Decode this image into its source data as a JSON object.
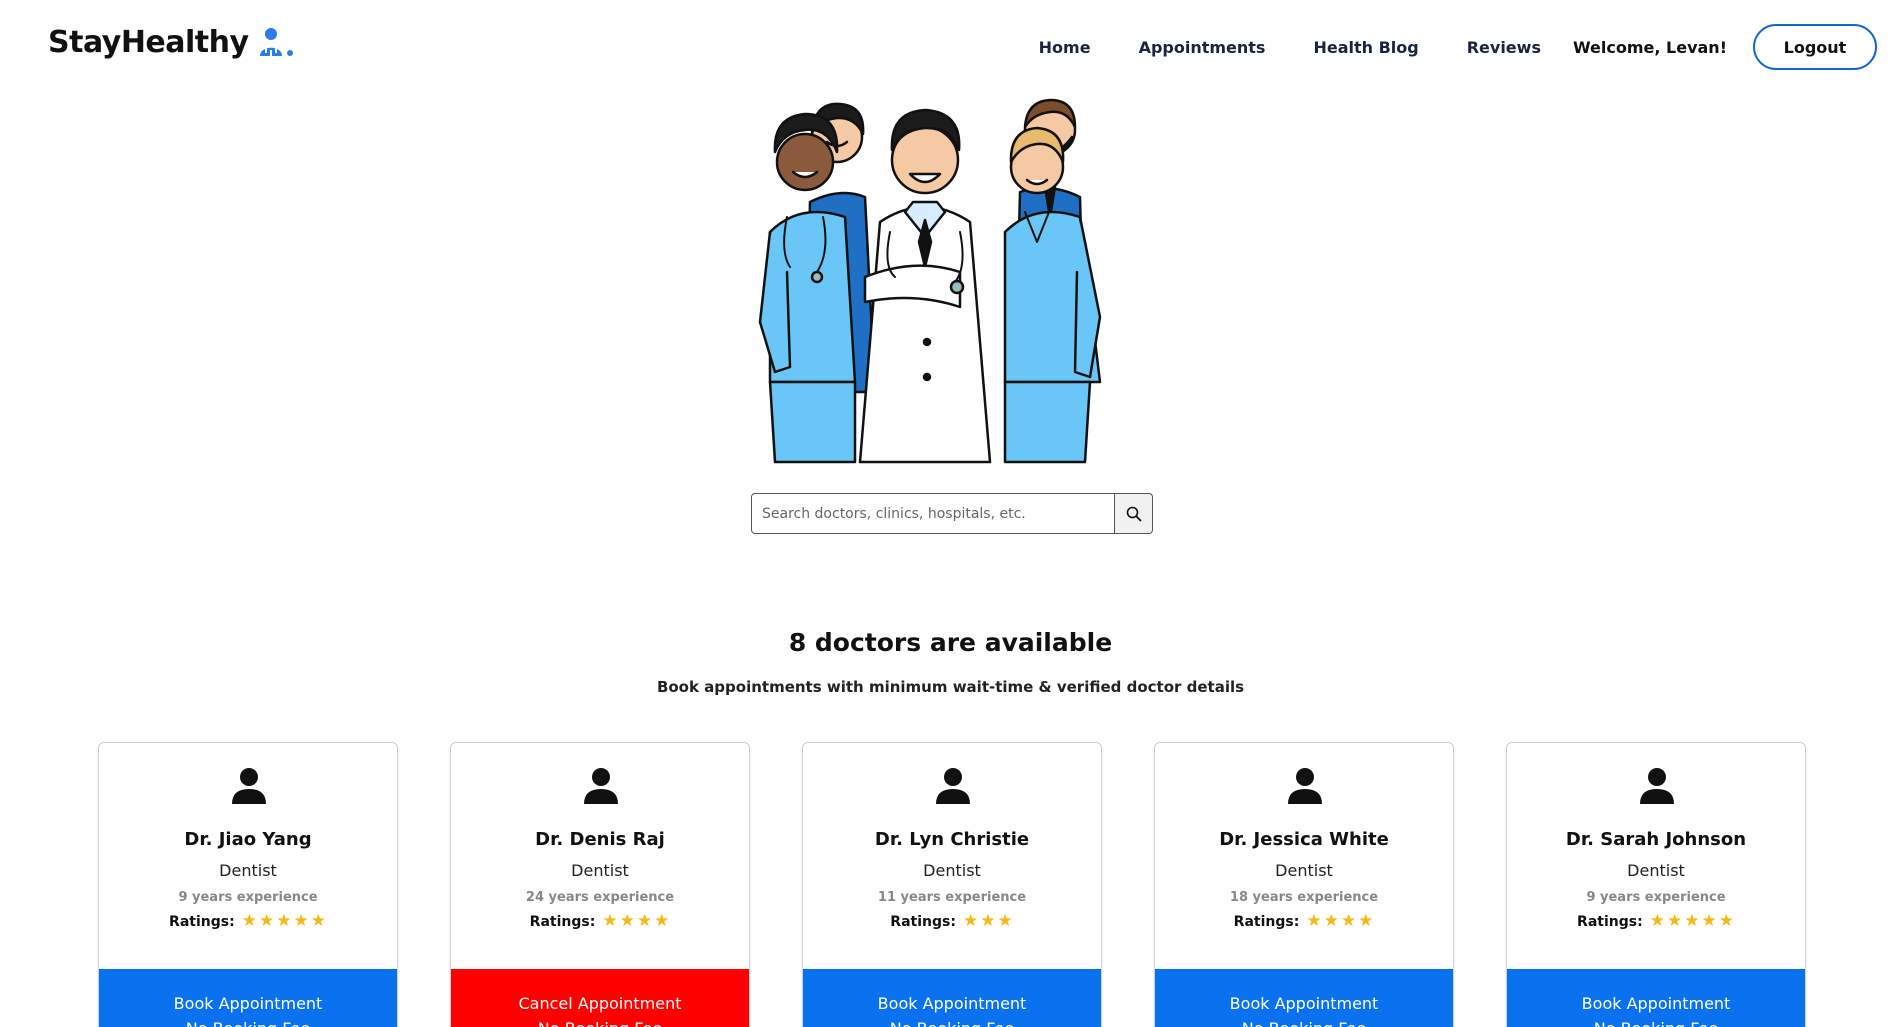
{
  "brand": {
    "name": "StayHealthy",
    "accent": "#1565d8"
  },
  "nav": {
    "links": [
      "Home",
      "Appointments",
      "Health Blog",
      "Reviews"
    ],
    "welcome": "Welcome, Levan!",
    "logout": "Logout"
  },
  "search": {
    "placeholder": "Search doctors, clinics, hospitals, etc.",
    "icon": "search-icon"
  },
  "heading": "8 doctors are available",
  "subheading": "Book appointments with minimum wait-time & verified doctor details",
  "ratings_label": "Ratings:",
  "colors": {
    "book": "#0a72ef",
    "cancel": "#ff0000",
    "star": "#f6b818"
  },
  "doctors": [
    {
      "name": "Dr. Jiao Yang",
      "speciality": "Dentist",
      "experience": "9 years experience",
      "rating": 5,
      "button": "Book Appointment",
      "fee": "No Booking Fee",
      "state": "book"
    },
    {
      "name": "Dr. Denis Raj",
      "speciality": "Dentist",
      "experience": "24 years experience",
      "rating": 4,
      "button": "Cancel Appointment",
      "fee": "No Booking Fee",
      "state": "cancel"
    },
    {
      "name": "Dr. Lyn Christie",
      "speciality": "Dentist",
      "experience": "11 years experience",
      "rating": 3,
      "button": "Book Appointment",
      "fee": "No Booking Fee",
      "state": "book"
    },
    {
      "name": "Dr. Jessica White",
      "speciality": "Dentist",
      "experience": "18 years experience",
      "rating": 4,
      "button": "Book Appointment",
      "fee": "No Booking Fee",
      "state": "book"
    },
    {
      "name": "Dr. Sarah Johnson",
      "speciality": "Dentist",
      "experience": "9 years experience",
      "rating": 5,
      "button": "Book Appointment",
      "fee": "No Booking Fee",
      "state": "book"
    }
  ]
}
